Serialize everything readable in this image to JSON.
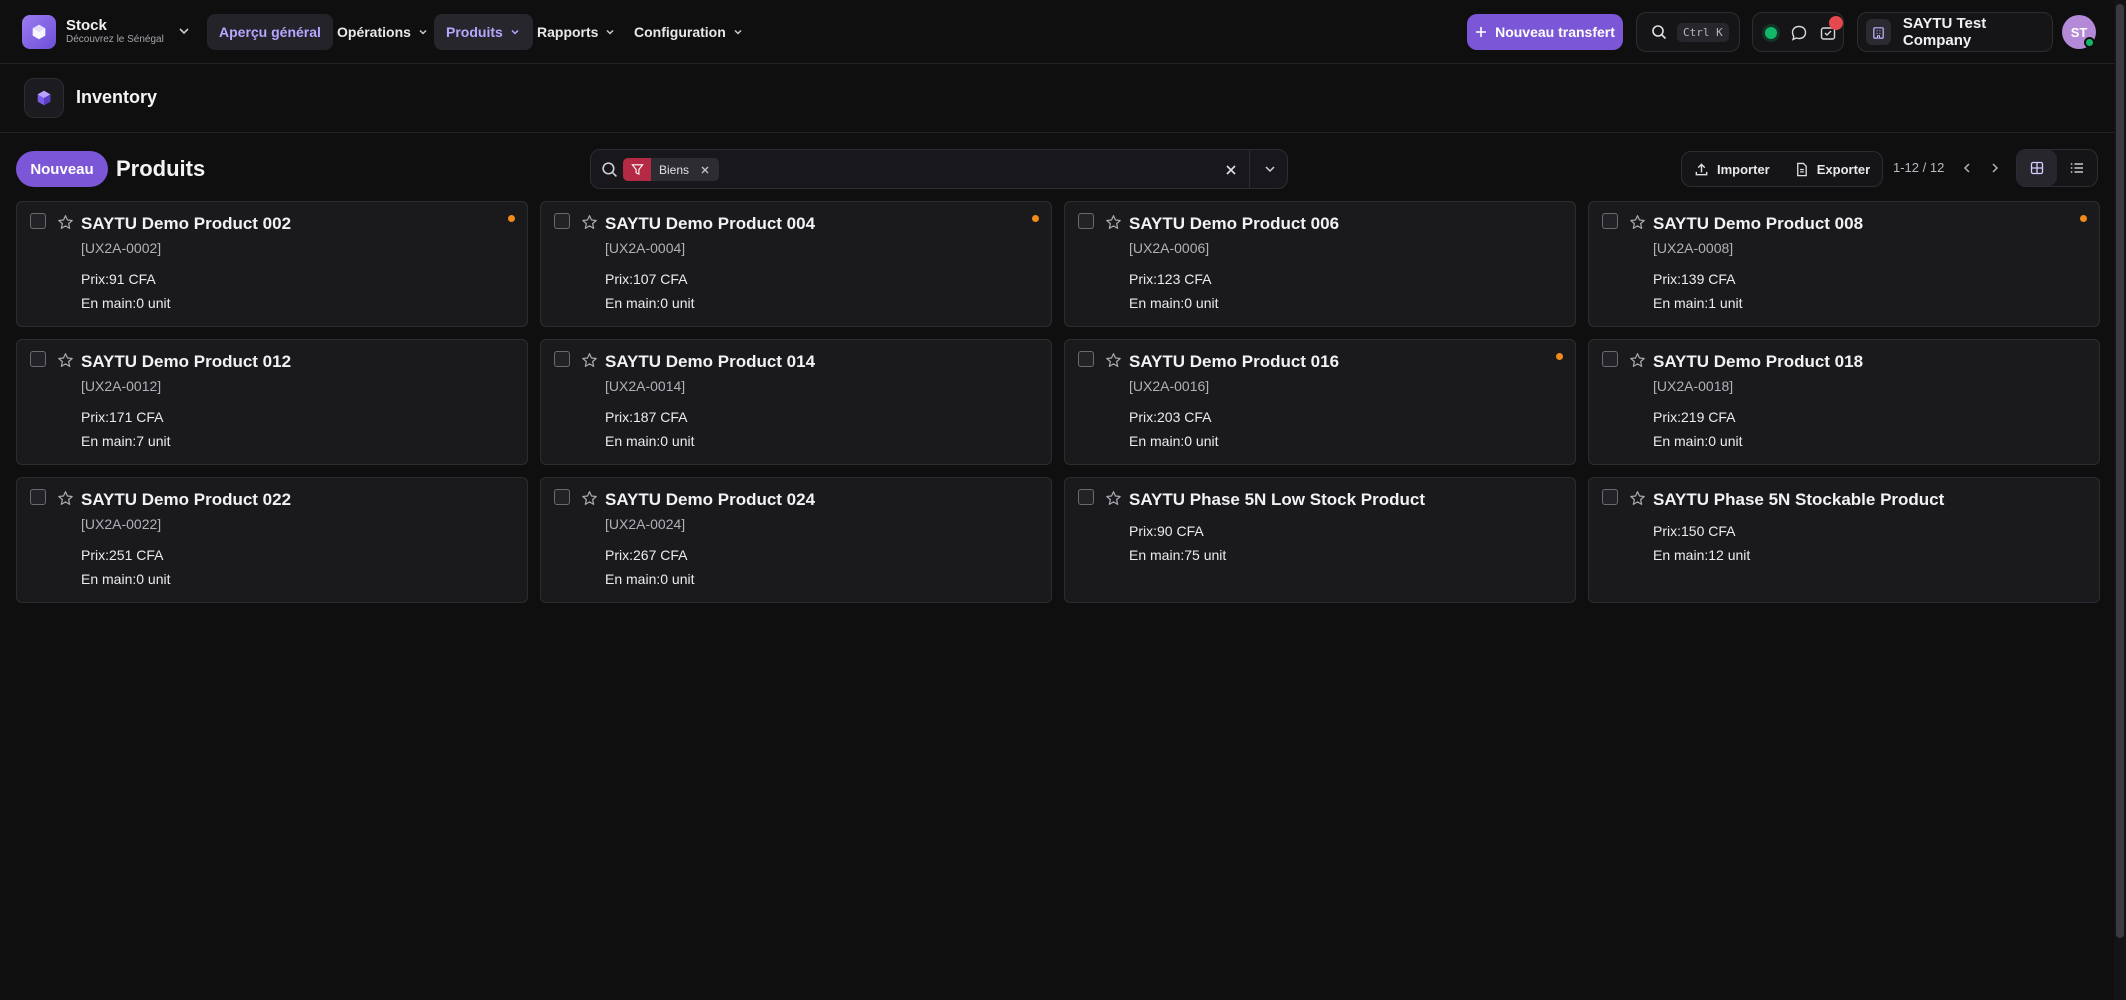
{
  "app": {
    "name": "Stock",
    "subtitle": "Découvrez le Sénégal"
  },
  "nav": [
    {
      "label": "Aperçu général",
      "state": "active",
      "has_menu": false
    },
    {
      "label": "Opérations",
      "state": "normal",
      "has_menu": true
    },
    {
      "label": "Produits",
      "state": "hover",
      "has_menu": true
    },
    {
      "label": "Rapports",
      "state": "normal",
      "has_menu": true
    },
    {
      "label": "Configuration",
      "state": "normal",
      "has_menu": true
    }
  ],
  "header": {
    "primary_action": "Nouveau transfert",
    "search_shortcut": "Ctrl K",
    "company": "SAYTU Test Company",
    "avatar_initials": "ST"
  },
  "module": {
    "title": "Inventory"
  },
  "toolbar": {
    "new_label": "Nouveau",
    "page_title": "Produits",
    "facet_label": "Biens",
    "import_label": "Importer",
    "export_label": "Exporter",
    "pager": "1-12 / 12"
  },
  "products": [
    {
      "name": "SAYTU Demo Product 002",
      "ref": "[UX2A-0002]",
      "price": "Prix:91 CFA",
      "on_hand": "En main:0 unit",
      "flag": true
    },
    {
      "name": "SAYTU Demo Product 004",
      "ref": "[UX2A-0004]",
      "price": "Prix:107 CFA",
      "on_hand": "En main:0 unit",
      "flag": true
    },
    {
      "name": "SAYTU Demo Product 006",
      "ref": "[UX2A-0006]",
      "price": "Prix:123 CFA",
      "on_hand": "En main:0 unit",
      "flag": false
    },
    {
      "name": "SAYTU Demo Product 008",
      "ref": "[UX2A-0008]",
      "price": "Prix:139 CFA",
      "on_hand": "En main:1 unit",
      "flag": true
    },
    {
      "name": "SAYTU Demo Product 012",
      "ref": "[UX2A-0012]",
      "price": "Prix:171 CFA",
      "on_hand": "En main:7 unit",
      "flag": false
    },
    {
      "name": "SAYTU Demo Product 014",
      "ref": "[UX2A-0014]",
      "price": "Prix:187 CFA",
      "on_hand": "En main:0 unit",
      "flag": false
    },
    {
      "name": "SAYTU Demo Product 016",
      "ref": "[UX2A-0016]",
      "price": "Prix:203 CFA",
      "on_hand": "En main:0 unit",
      "flag": true
    },
    {
      "name": "SAYTU Demo Product 018",
      "ref": "[UX2A-0018]",
      "price": "Prix:219 CFA",
      "on_hand": "En main:0 unit",
      "flag": false
    },
    {
      "name": "SAYTU Demo Product 022",
      "ref": "[UX2A-0022]",
      "price": "Prix:251 CFA",
      "on_hand": "En main:0 unit",
      "flag": false
    },
    {
      "name": "SAYTU Demo Product 024",
      "ref": "[UX2A-0024]",
      "price": "Prix:267 CFA",
      "on_hand": "En main:0 unit",
      "flag": false
    },
    {
      "name": "SAYTU Phase 5N Low Stock Product",
      "ref": "",
      "price": "Prix:90 CFA",
      "on_hand": "En main:75 unit",
      "flag": false
    },
    {
      "name": "SAYTU Phase 5N Stockable Product",
      "ref": "",
      "price": "Prix:150 CFA",
      "on_hand": "En main:12 unit",
      "flag": false
    }
  ],
  "colors": {
    "accent": "#7b56d6",
    "status_online": "#12b76a",
    "flag": "#f28a1a",
    "facet": "#b42a45"
  },
  "icons": [
    "cube-icon",
    "chevron-down-icon",
    "plus-icon",
    "search-icon",
    "chat-icon",
    "activity-icon",
    "building-icon",
    "filter-icon",
    "close-icon",
    "upload-icon",
    "file-icon",
    "chevron-left-icon",
    "chevron-right-icon",
    "grid-view-icon",
    "list-view-icon",
    "star-icon"
  ]
}
